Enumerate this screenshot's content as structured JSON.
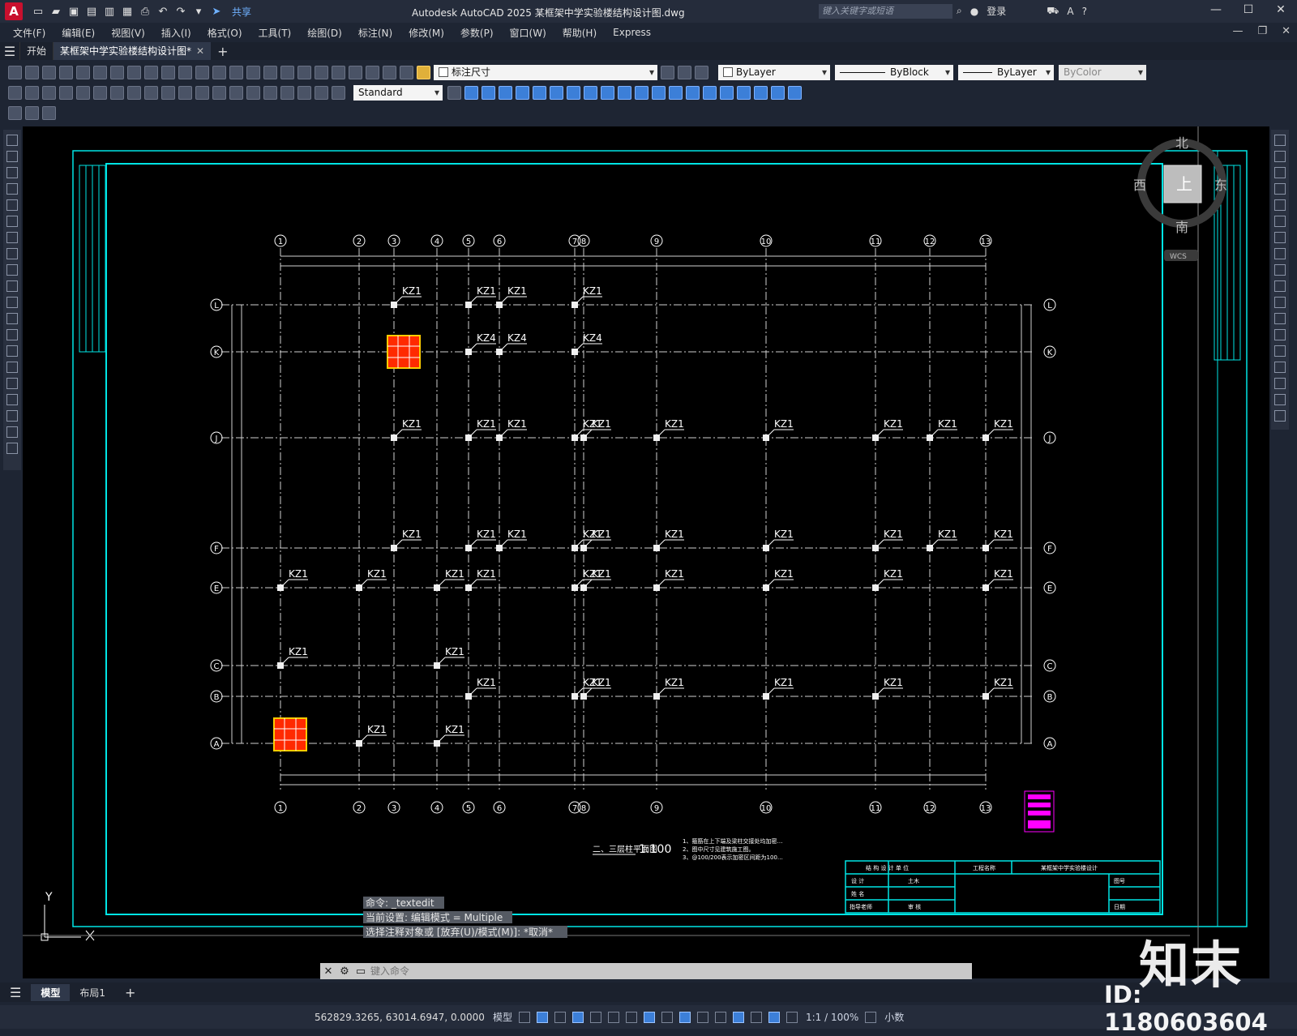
{
  "titlebar": {
    "logo": "A",
    "share": "共享",
    "title": "Autodesk AutoCAD 2025    某框架中学实验楼结构设计图.dwg",
    "search_placeholder": "键入关键字或短语",
    "login": "登录",
    "minimize": "—",
    "maximize": "☐",
    "close": "✕"
  },
  "menu": {
    "items": [
      "文件(F)",
      "编辑(E)",
      "视图(V)",
      "插入(I)",
      "格式(O)",
      "工具(T)",
      "绘图(D)",
      "标注(N)",
      "修改(M)",
      "参数(P)",
      "窗口(W)",
      "帮助(H)",
      "Express"
    ]
  },
  "tabs": {
    "start": "开始",
    "document": "某框架中学实验楼结构设计图*",
    "close": "✕",
    "add": "+"
  },
  "toolbar": {
    "layer_value": "标注尺寸",
    "style_value": "Standard",
    "color_value": "ByLayer",
    "linetype_value": "ByBlock",
    "lineweight_value": "ByLayer",
    "plotstyle_value": "ByColor"
  },
  "viewcube": {
    "north": "北",
    "south": "南",
    "east": "东",
    "west": "西",
    "top": "上",
    "wcs": "WCS"
  },
  "drawing": {
    "col_labels": [
      "1",
      "2",
      "3",
      "4",
      "5",
      "6",
      "7",
      "8",
      "9",
      "10",
      "11",
      "12",
      "13"
    ],
    "row_labels": [
      "L",
      "K",
      "J",
      "F",
      "E",
      "C",
      "B",
      "A"
    ],
    "column_label": "KZ1",
    "column_label_alt": "KZ4",
    "caption": "二、三层柱平面图",
    "scale": "1:100",
    "notes": [
      "1、箍筋在上下端及梁柱交接处均加密…",
      "2、图中尺寸见建筑施工图。",
      "3、@100/200表示加密区间距为100…"
    ],
    "title_block": [
      "结 构 设 计 单 位",
      "工程名称",
      "某框架中学实验楼设计",
      "设 计",
      "土木",
      "姓 名",
      "指导老师",
      "审 核",
      "图号",
      "日期"
    ],
    "ucs_y": "Y"
  },
  "command": {
    "history": [
      "命令: _textedit",
      "当前设置: 编辑模式 = Multiple",
      "选择注释对象或 [放弃(U)/模式(M)]: *取消*"
    ],
    "placeholder": "键入命令"
  },
  "layouts": {
    "model": "模型",
    "layout1": "布局1",
    "add": "+"
  },
  "status": {
    "coordinates": "562829.3265, 63014.6947, 0.0000",
    "mode": "模型",
    "scale": "1:1 / 100%",
    "units": "小数"
  },
  "watermark": {
    "brand": "知末",
    "id": "ID: 1180603604"
  }
}
